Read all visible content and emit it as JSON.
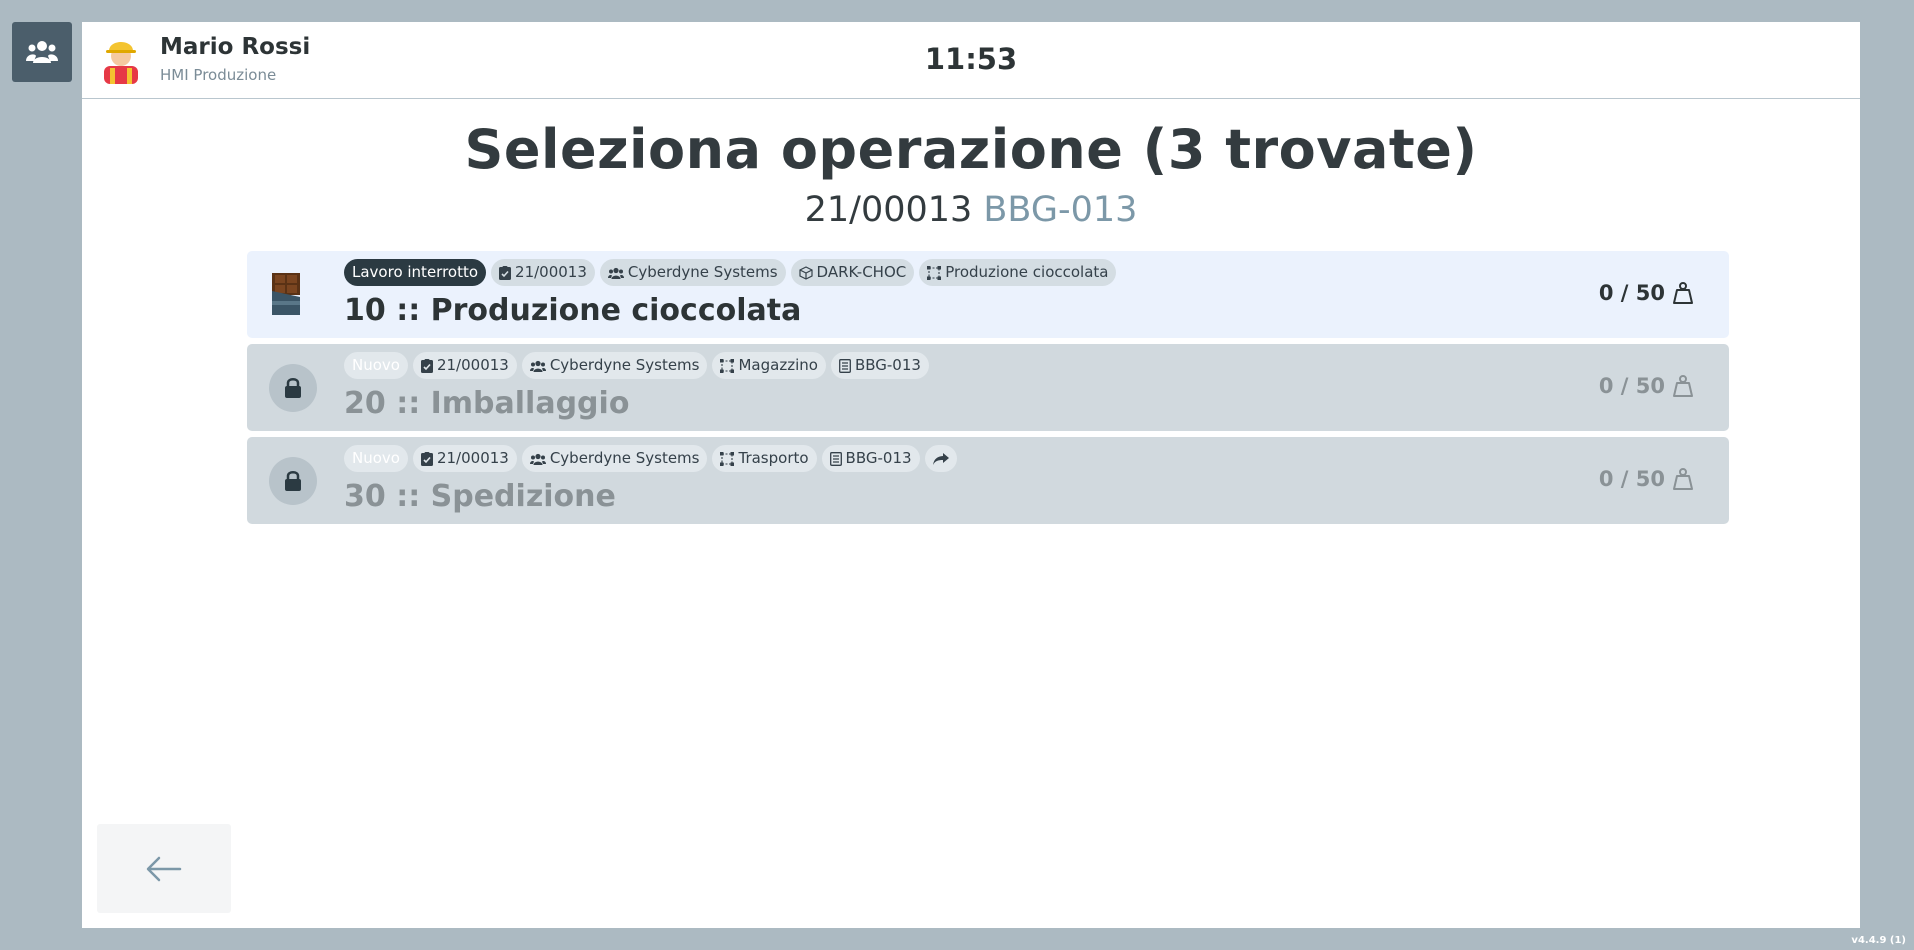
{
  "header": {
    "user_name": "Mario Rossi",
    "user_role": "HMI Produzione",
    "clock": "11:53"
  },
  "page": {
    "title": "Seleziona operazione (3 trovate)",
    "order_number": "21/00013",
    "order_code": "BBG-013"
  },
  "operations": [
    {
      "status": "Lavoro interrotto",
      "order": "21/00013",
      "customer": "Cyberdyne Systems",
      "article": "DARK-CHOC",
      "workcenter": "Produzione cioccolata",
      "title": "10 :: Produzione cioccolata",
      "quantity": "0 / 50",
      "state": "active"
    },
    {
      "status": "Nuovo",
      "order": "21/00013",
      "customer": "Cyberdyne Systems",
      "workcenter": "Magazzino",
      "document": "BBG-013",
      "title": "20 :: Imballaggio",
      "quantity": "0 / 50",
      "state": "locked"
    },
    {
      "status": "Nuovo",
      "order": "21/00013",
      "customer": "Cyberdyne Systems",
      "workcenter": "Trasporto",
      "document": "BBG-013",
      "title": "30 :: Spedizione",
      "quantity": "0 / 50",
      "state": "locked"
    }
  ],
  "footer": {
    "version": "v4.4.9 (1)"
  },
  "colors": {
    "background": "#acbac2",
    "side_button": "#4b5e6b",
    "active_row": "#ebf2fd",
    "locked_row": "#d1d9de",
    "status_badge": "#2b3a42",
    "code_accent": "#7c98a8"
  }
}
